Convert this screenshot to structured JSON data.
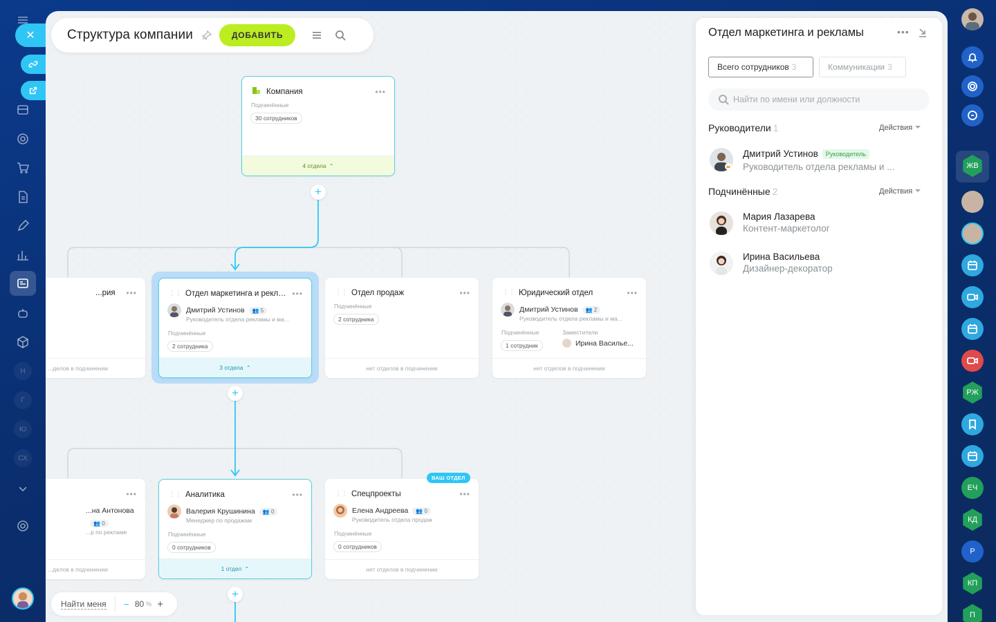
{
  "toolbar": {
    "title": "Структура компании",
    "add_label": "ДОБАВИТЬ"
  },
  "company_card": {
    "name": "Компания",
    "sub_label": "Подчинённые",
    "sub_count": "30 сотрудников",
    "footer": "4 отдела"
  },
  "cards_row1": {
    "left": {
      "name": "...рия",
      "footer": "...делов в подчинении"
    },
    "marketing": {
      "name": "Отдел маркетинга и рекла...",
      "head_name": "Дмитрий Устинов",
      "head_count": "5",
      "head_role": "Руководитель отдела рекламы и ма...",
      "sub_label": "Подчинённые",
      "sub_count": "2 сотрудника",
      "footer": "3 отдела"
    },
    "sales": {
      "name": "Отдел продаж",
      "sub_label": "Подчинённые",
      "sub_count": "2 сотрудника",
      "footer": "нет отделов в подчинении"
    },
    "legal": {
      "name": "Юридический отдел",
      "head_name": "Дмитрий Устинов",
      "head_count": "2",
      "head_role": "Руководитель отдела рекламы и ма...",
      "sub_label": "Подчинённые",
      "sub_count": "1 сотрудник",
      "deputy_label": "Заместители",
      "deputy_name": "Ирина Василье...",
      "footer": "нет отделов в подчинении"
    }
  },
  "cards_row2": {
    "left": {
      "head_name": "...на Антонова",
      "head_count": "0",
      "head_role": "...р по рекламе",
      "footer": "...делов в подчинении"
    },
    "analytics": {
      "name": "Аналитика",
      "head_name": "Валерия Крушинина",
      "head_count": "0",
      "head_role": "Менеджер по продажам",
      "sub_label": "Подчинённые",
      "sub_count": "0 сотрудников",
      "footer": "1 отдел"
    },
    "special": {
      "badge": "ВАШ ОТДЕЛ",
      "name": "Спецпроекты",
      "head_name": "Елена Андреева",
      "head_count": "0",
      "head_role": "Руководитель отдела продаж",
      "sub_label": "Подчинённые",
      "sub_count": "0 сотрудников",
      "footer": "нет отделов в подчинении"
    }
  },
  "zoom": {
    "find_me": "Найти меня",
    "value": "80",
    "unit": "%"
  },
  "panel": {
    "title": "Отдел маркетинга и рекламы",
    "tab_employees": "Всего сотрудников",
    "tab_employees_count": "3",
    "tab_comms": "Коммуникации",
    "tab_comms_count": "3",
    "search_placeholder": "Найти по имени или должности",
    "heads_title": "Руководители",
    "heads_count": "1",
    "actions_label": "Действия",
    "head": {
      "name": "Дмитрий Устинов",
      "tag": "Руководитель",
      "role": "Руководитель отдела рекламы и ..."
    },
    "subs_title": "Подчинённые",
    "subs_count": "2",
    "subs": [
      {
        "name": "Мария Лазарева",
        "role": "Контент-маркетолог"
      },
      {
        "name": "Ирина Васильева",
        "role": "Дизайнер-декоратор"
      }
    ]
  },
  "left_rail_letters": [
    "Н",
    "Г",
    "Ю",
    "СХ"
  ],
  "right_rail_letters": [
    "ЖВ",
    "РЖ",
    "ЕЧ",
    "КД",
    "Р",
    "КП",
    "П"
  ],
  "colors": {
    "accent": "#2fc6f6",
    "add_button": "#bbed21",
    "rail_bg": "#0b3a8c"
  }
}
